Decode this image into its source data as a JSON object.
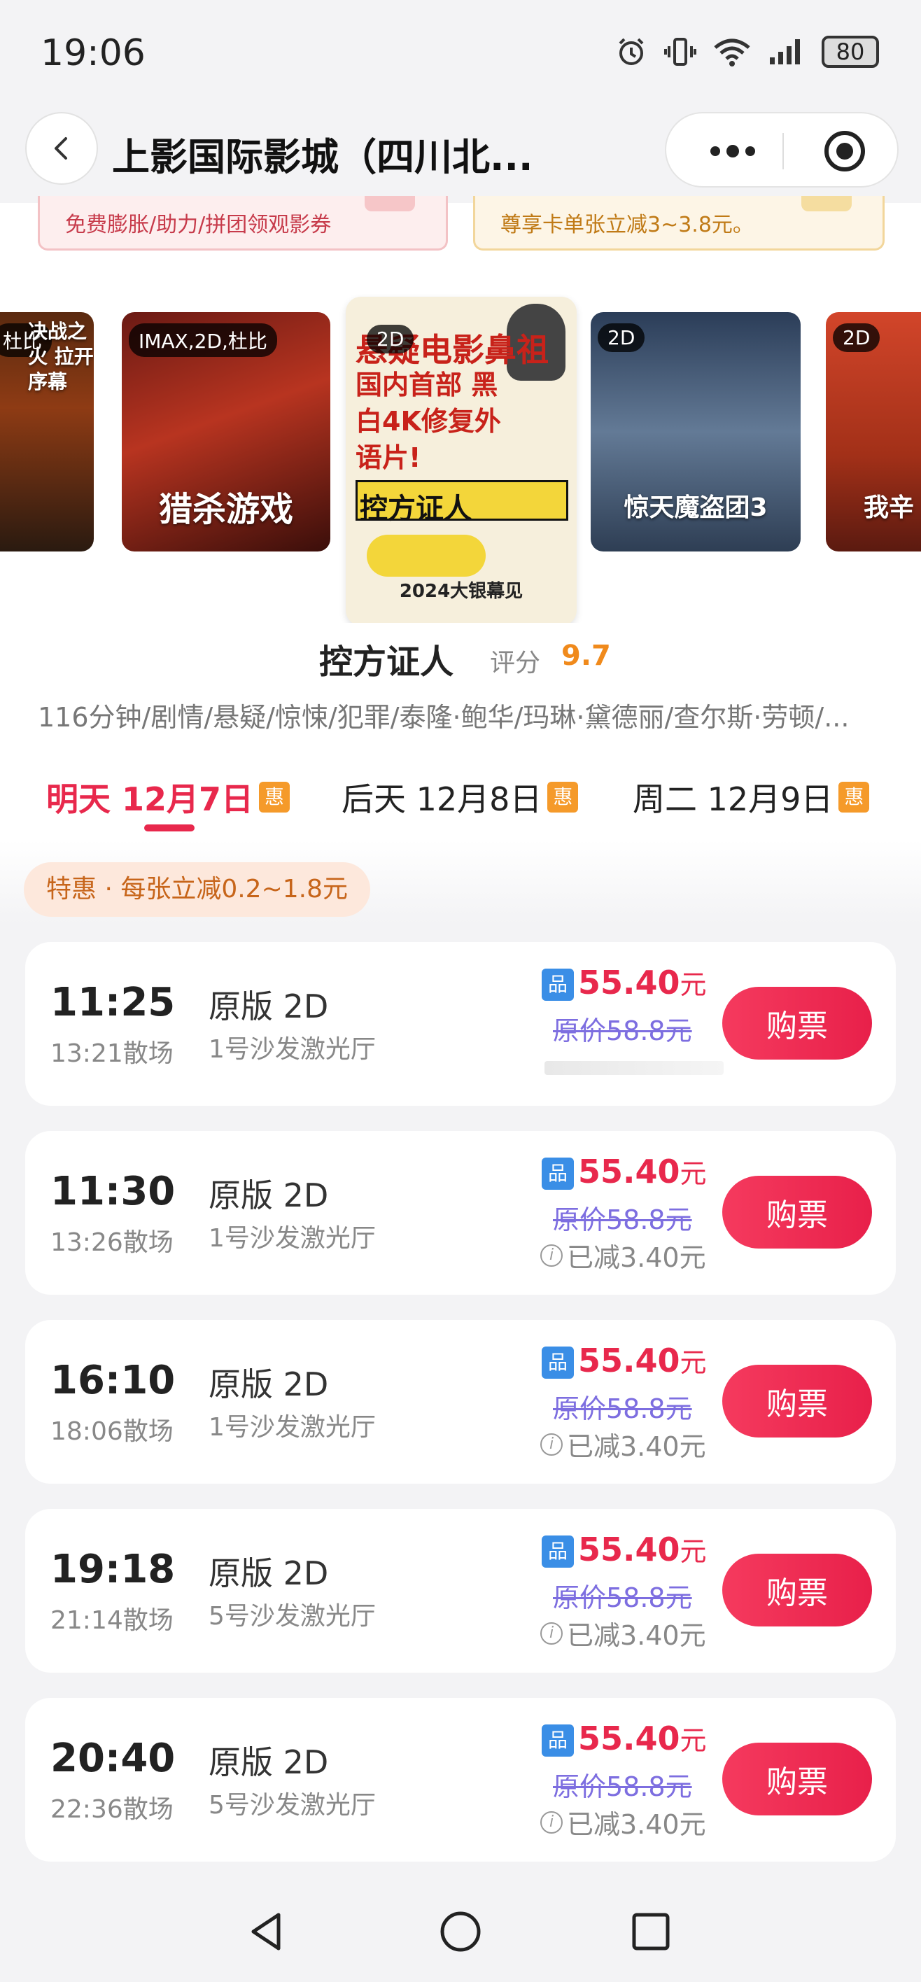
{
  "status_bar": {
    "time": "19:06",
    "battery": "80"
  },
  "header": {
    "title": "上影国际影城（四川北..."
  },
  "promos": [
    {
      "text": "免费膨胀/助力/拼团领观影券"
    },
    {
      "text": "尊享卡单张立减3~3.8元。"
    }
  ],
  "posters": [
    {
      "badge": "杜比",
      "title": "决战之火 拉开序幕"
    },
    {
      "badge": "IMAX,2D,杜比",
      "title": "猎杀游戏"
    },
    {
      "badge": "2D",
      "title": "控方证人",
      "line1": "悬疑电影鼻祖",
      "line2": "国内首部 黑白4K修复外语片!",
      "block": "控方证人 WITNESS FOR THE PROSECUTION",
      "year": "2024大银幕见"
    },
    {
      "badge": "2D",
      "title": "惊天魔盗团3"
    },
    {
      "badge": "2D",
      "title": "我辛"
    }
  ],
  "movie": {
    "title": "控方证人",
    "rating_label": "评分",
    "rating": "9.7",
    "meta": "116分钟/剧情/悬疑/惊悚/犯罪/泰隆·鲍华/玛琳·黛德丽/查尔斯·劳顿/..."
  },
  "date_tabs": [
    {
      "label": "明天 12月7日",
      "hui": "惠"
    },
    {
      "label": "后天 12月8日",
      "hui": "惠"
    },
    {
      "label": "周二 12月9日",
      "hui": "惠"
    }
  ],
  "discount_pill": "特惠 · 每张立减0.2~1.8元",
  "showtimes": [
    {
      "time": "11:25",
      "end": "13:21散场",
      "version": "原版 2D",
      "hall": "1号沙发激光厅",
      "tag": "品",
      "price": "55.40",
      "unit": "元",
      "orig": "原价58.8元",
      "saved": "",
      "buy": "购票"
    },
    {
      "time": "11:30",
      "end": "13:26散场",
      "version": "原版 2D",
      "hall": "1号沙发激光厅",
      "tag": "品",
      "price": "55.40",
      "unit": "元",
      "orig": "原价58.8元",
      "saved": "已减3.40元",
      "buy": "购票"
    },
    {
      "time": "16:10",
      "end": "18:06散场",
      "version": "原版 2D",
      "hall": "1号沙发激光厅",
      "tag": "品",
      "price": "55.40",
      "unit": "元",
      "orig": "原价58.8元",
      "saved": "已减3.40元",
      "buy": "购票"
    },
    {
      "time": "19:18",
      "end": "21:14散场",
      "version": "原版 2D",
      "hall": "5号沙发激光厅",
      "tag": "品",
      "price": "55.40",
      "unit": "元",
      "orig": "原价58.8元",
      "saved": "已减3.40元",
      "buy": "购票"
    },
    {
      "time": "20:40",
      "end": "22:36散场",
      "version": "原版 2D",
      "hall": "5号沙发激光厅",
      "tag": "品",
      "price": "55.40",
      "unit": "元",
      "orig": "原价58.8元",
      "saved": "已减3.40元",
      "buy": "购票"
    }
  ],
  "colors": {
    "accent": "#e8284c",
    "rating": "#f08a1c",
    "orig_price": "#7d6ee0",
    "hui": "#f59a2a",
    "pin": "#3a8ee6"
  }
}
